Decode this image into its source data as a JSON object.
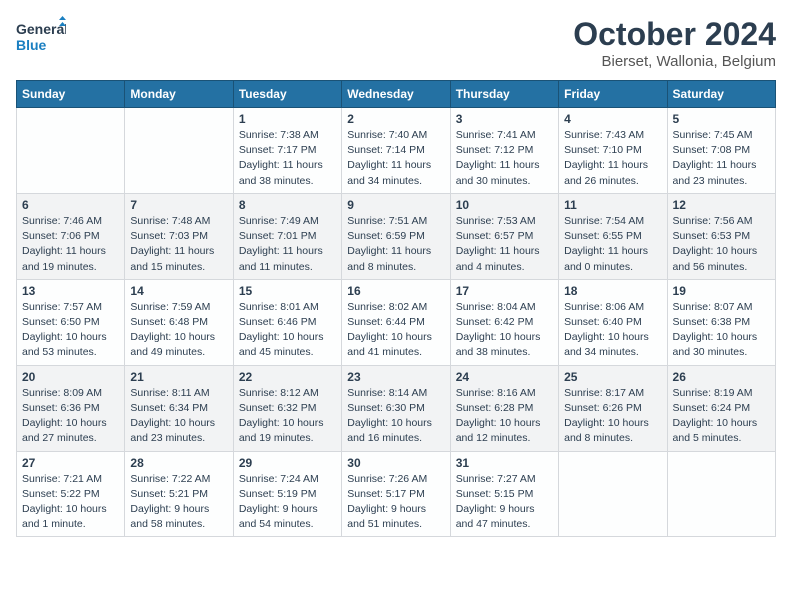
{
  "header": {
    "logo_general": "General",
    "logo_blue": "Blue",
    "title": "October 2024",
    "subtitle": "Bierset, Wallonia, Belgium"
  },
  "days_of_week": [
    "Sunday",
    "Monday",
    "Tuesday",
    "Wednesday",
    "Thursday",
    "Friday",
    "Saturday"
  ],
  "weeks": [
    [
      {
        "day": "",
        "sunrise": "",
        "sunset": "",
        "daylight": ""
      },
      {
        "day": "",
        "sunrise": "",
        "sunset": "",
        "daylight": ""
      },
      {
        "day": "1",
        "sunrise": "Sunrise: 7:38 AM",
        "sunset": "Sunset: 7:17 PM",
        "daylight": "Daylight: 11 hours and 38 minutes."
      },
      {
        "day": "2",
        "sunrise": "Sunrise: 7:40 AM",
        "sunset": "Sunset: 7:14 PM",
        "daylight": "Daylight: 11 hours and 34 minutes."
      },
      {
        "day": "3",
        "sunrise": "Sunrise: 7:41 AM",
        "sunset": "Sunset: 7:12 PM",
        "daylight": "Daylight: 11 hours and 30 minutes."
      },
      {
        "day": "4",
        "sunrise": "Sunrise: 7:43 AM",
        "sunset": "Sunset: 7:10 PM",
        "daylight": "Daylight: 11 hours and 26 minutes."
      },
      {
        "day": "5",
        "sunrise": "Sunrise: 7:45 AM",
        "sunset": "Sunset: 7:08 PM",
        "daylight": "Daylight: 11 hours and 23 minutes."
      }
    ],
    [
      {
        "day": "6",
        "sunrise": "Sunrise: 7:46 AM",
        "sunset": "Sunset: 7:06 PM",
        "daylight": "Daylight: 11 hours and 19 minutes."
      },
      {
        "day": "7",
        "sunrise": "Sunrise: 7:48 AM",
        "sunset": "Sunset: 7:03 PM",
        "daylight": "Daylight: 11 hours and 15 minutes."
      },
      {
        "day": "8",
        "sunrise": "Sunrise: 7:49 AM",
        "sunset": "Sunset: 7:01 PM",
        "daylight": "Daylight: 11 hours and 11 minutes."
      },
      {
        "day": "9",
        "sunrise": "Sunrise: 7:51 AM",
        "sunset": "Sunset: 6:59 PM",
        "daylight": "Daylight: 11 hours and 8 minutes."
      },
      {
        "day": "10",
        "sunrise": "Sunrise: 7:53 AM",
        "sunset": "Sunset: 6:57 PM",
        "daylight": "Daylight: 11 hours and 4 minutes."
      },
      {
        "day": "11",
        "sunrise": "Sunrise: 7:54 AM",
        "sunset": "Sunset: 6:55 PM",
        "daylight": "Daylight: 11 hours and 0 minutes."
      },
      {
        "day": "12",
        "sunrise": "Sunrise: 7:56 AM",
        "sunset": "Sunset: 6:53 PM",
        "daylight": "Daylight: 10 hours and 56 minutes."
      }
    ],
    [
      {
        "day": "13",
        "sunrise": "Sunrise: 7:57 AM",
        "sunset": "Sunset: 6:50 PM",
        "daylight": "Daylight: 10 hours and 53 minutes."
      },
      {
        "day": "14",
        "sunrise": "Sunrise: 7:59 AM",
        "sunset": "Sunset: 6:48 PM",
        "daylight": "Daylight: 10 hours and 49 minutes."
      },
      {
        "day": "15",
        "sunrise": "Sunrise: 8:01 AM",
        "sunset": "Sunset: 6:46 PM",
        "daylight": "Daylight: 10 hours and 45 minutes."
      },
      {
        "day": "16",
        "sunrise": "Sunrise: 8:02 AM",
        "sunset": "Sunset: 6:44 PM",
        "daylight": "Daylight: 10 hours and 41 minutes."
      },
      {
        "day": "17",
        "sunrise": "Sunrise: 8:04 AM",
        "sunset": "Sunset: 6:42 PM",
        "daylight": "Daylight: 10 hours and 38 minutes."
      },
      {
        "day": "18",
        "sunrise": "Sunrise: 8:06 AM",
        "sunset": "Sunset: 6:40 PM",
        "daylight": "Daylight: 10 hours and 34 minutes."
      },
      {
        "day": "19",
        "sunrise": "Sunrise: 8:07 AM",
        "sunset": "Sunset: 6:38 PM",
        "daylight": "Daylight: 10 hours and 30 minutes."
      }
    ],
    [
      {
        "day": "20",
        "sunrise": "Sunrise: 8:09 AM",
        "sunset": "Sunset: 6:36 PM",
        "daylight": "Daylight: 10 hours and 27 minutes."
      },
      {
        "day": "21",
        "sunrise": "Sunrise: 8:11 AM",
        "sunset": "Sunset: 6:34 PM",
        "daylight": "Daylight: 10 hours and 23 minutes."
      },
      {
        "day": "22",
        "sunrise": "Sunrise: 8:12 AM",
        "sunset": "Sunset: 6:32 PM",
        "daylight": "Daylight: 10 hours and 19 minutes."
      },
      {
        "day": "23",
        "sunrise": "Sunrise: 8:14 AM",
        "sunset": "Sunset: 6:30 PM",
        "daylight": "Daylight: 10 hours and 16 minutes."
      },
      {
        "day": "24",
        "sunrise": "Sunrise: 8:16 AM",
        "sunset": "Sunset: 6:28 PM",
        "daylight": "Daylight: 10 hours and 12 minutes."
      },
      {
        "day": "25",
        "sunrise": "Sunrise: 8:17 AM",
        "sunset": "Sunset: 6:26 PM",
        "daylight": "Daylight: 10 hours and 8 minutes."
      },
      {
        "day": "26",
        "sunrise": "Sunrise: 8:19 AM",
        "sunset": "Sunset: 6:24 PM",
        "daylight": "Daylight: 10 hours and 5 minutes."
      }
    ],
    [
      {
        "day": "27",
        "sunrise": "Sunrise: 7:21 AM",
        "sunset": "Sunset: 5:22 PM",
        "daylight": "Daylight: 10 hours and 1 minute."
      },
      {
        "day": "28",
        "sunrise": "Sunrise: 7:22 AM",
        "sunset": "Sunset: 5:21 PM",
        "daylight": "Daylight: 9 hours and 58 minutes."
      },
      {
        "day": "29",
        "sunrise": "Sunrise: 7:24 AM",
        "sunset": "Sunset: 5:19 PM",
        "daylight": "Daylight: 9 hours and 54 minutes."
      },
      {
        "day": "30",
        "sunrise": "Sunrise: 7:26 AM",
        "sunset": "Sunset: 5:17 PM",
        "daylight": "Daylight: 9 hours and 51 minutes."
      },
      {
        "day": "31",
        "sunrise": "Sunrise: 7:27 AM",
        "sunset": "Sunset: 5:15 PM",
        "daylight": "Daylight: 9 hours and 47 minutes."
      },
      {
        "day": "",
        "sunrise": "",
        "sunset": "",
        "daylight": ""
      },
      {
        "day": "",
        "sunrise": "",
        "sunset": "",
        "daylight": ""
      }
    ]
  ]
}
